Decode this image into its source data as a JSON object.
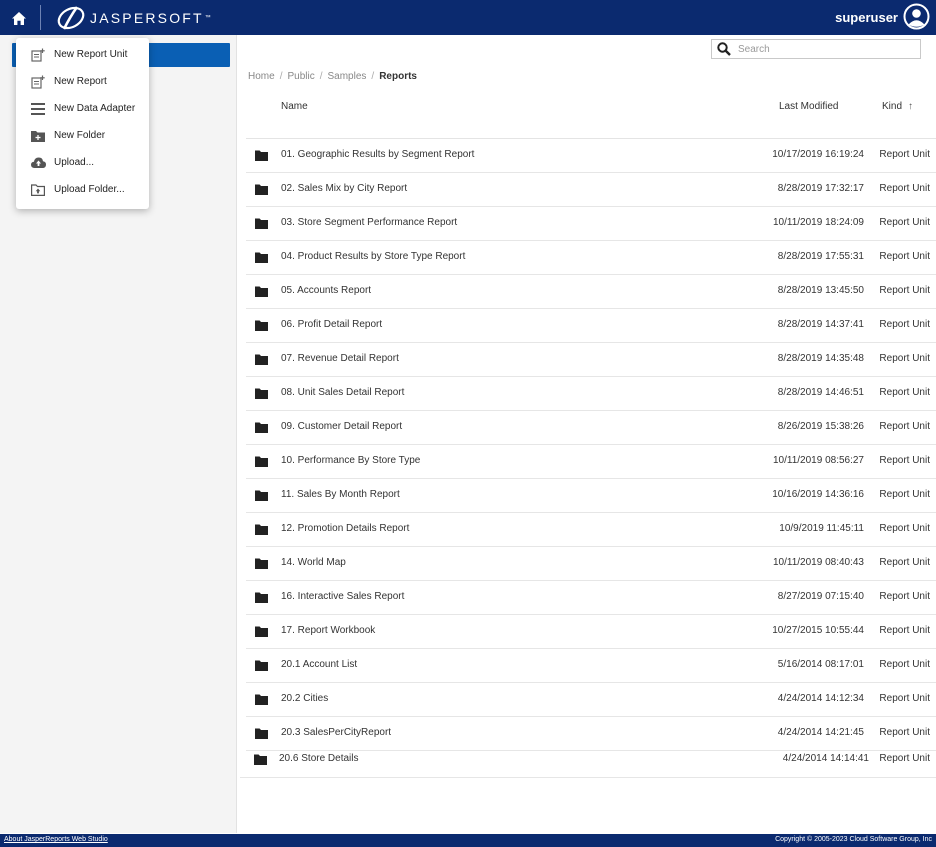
{
  "header": {
    "brand": "JASPERSOFT",
    "brand_mark": "™",
    "user_name": "superuser"
  },
  "menu": {
    "items": [
      {
        "label": "New Report Unit",
        "icon": "new-report-unit-icon"
      },
      {
        "label": "New Report",
        "icon": "new-report-icon"
      },
      {
        "label": "New Data Adapter",
        "icon": "data-adapter-icon"
      },
      {
        "label": "New Folder",
        "icon": "new-folder-icon"
      },
      {
        "label": "Upload...",
        "icon": "cloud-upload-icon"
      },
      {
        "label": "Upload Folder...",
        "icon": "upload-folder-icon"
      }
    ]
  },
  "search": {
    "placeholder": "Search"
  },
  "breadcrumb": {
    "items": [
      "Home",
      "Public",
      "Samples"
    ],
    "separator": "/",
    "current": "Reports"
  },
  "table": {
    "columns": {
      "name": "Name",
      "last_modified": "Last Modified",
      "kind": "Kind"
    },
    "sort_indicator": "↑",
    "rows": [
      {
        "name": "01. Geographic Results by Segment Report",
        "modified": "10/17/2019 16:19:24",
        "kind": "Report Unit"
      },
      {
        "name": "02. Sales Mix by City Report",
        "modified": "8/28/2019 17:32:17",
        "kind": "Report Unit"
      },
      {
        "name": "03. Store Segment Performance Report",
        "modified": "10/11/2019 18:24:09",
        "kind": "Report Unit"
      },
      {
        "name": "04. Product Results by Store Type Report",
        "modified": "8/28/2019 17:55:31",
        "kind": "Report Unit"
      },
      {
        "name": "05. Accounts Report",
        "modified": "8/28/2019 13:45:50",
        "kind": "Report Unit"
      },
      {
        "name": "06. Profit Detail Report",
        "modified": "8/28/2019 14:37:41",
        "kind": "Report Unit"
      },
      {
        "name": "07. Revenue Detail Report",
        "modified": "8/28/2019 14:35:48",
        "kind": "Report Unit"
      },
      {
        "name": "08. Unit Sales Detail Report",
        "modified": "8/28/2019 14:46:51",
        "kind": "Report Unit"
      },
      {
        "name": "09. Customer Detail Report",
        "modified": "8/26/2019 15:38:26",
        "kind": "Report Unit"
      },
      {
        "name": "10. Performance By Store Type",
        "modified": "10/11/2019 08:56:27",
        "kind": "Report Unit"
      },
      {
        "name": "11. Sales By Month Report",
        "modified": "10/16/2019 14:36:16",
        "kind": "Report Unit"
      },
      {
        "name": "12. Promotion Details Report",
        "modified": "10/9/2019 11:45:11",
        "kind": "Report Unit"
      },
      {
        "name": "14. World Map",
        "modified": "10/11/2019 08:40:43",
        "kind": "Report Unit"
      },
      {
        "name": "16. Interactive Sales Report",
        "modified": "8/27/2019 07:15:40",
        "kind": "Report Unit"
      },
      {
        "name": "17. Report Workbook",
        "modified": "10/27/2015 10:55:44",
        "kind": "Report Unit"
      },
      {
        "name": "20.1 Account List",
        "modified": "5/16/2014 08:17:01",
        "kind": "Report Unit"
      },
      {
        "name": "20.2 Cities",
        "modified": "4/24/2014 14:12:34",
        "kind": "Report Unit"
      },
      {
        "name": "20.3 SalesPerCityReport",
        "modified": "4/24/2014 14:21:45",
        "kind": "Report Unit"
      },
      {
        "name": "20.6 Store Details",
        "modified": "4/24/2014 14:14:41",
        "kind": "Report Unit"
      }
    ]
  },
  "footer": {
    "left": "About JasperReports Web Studio",
    "right": "Copyright © 2005-2023 Cloud Software Group, Inc"
  },
  "colors": {
    "header_bg": "#0b2a6f",
    "selection": "#0a5fb4",
    "panel_bg": "#f4f4f4"
  }
}
